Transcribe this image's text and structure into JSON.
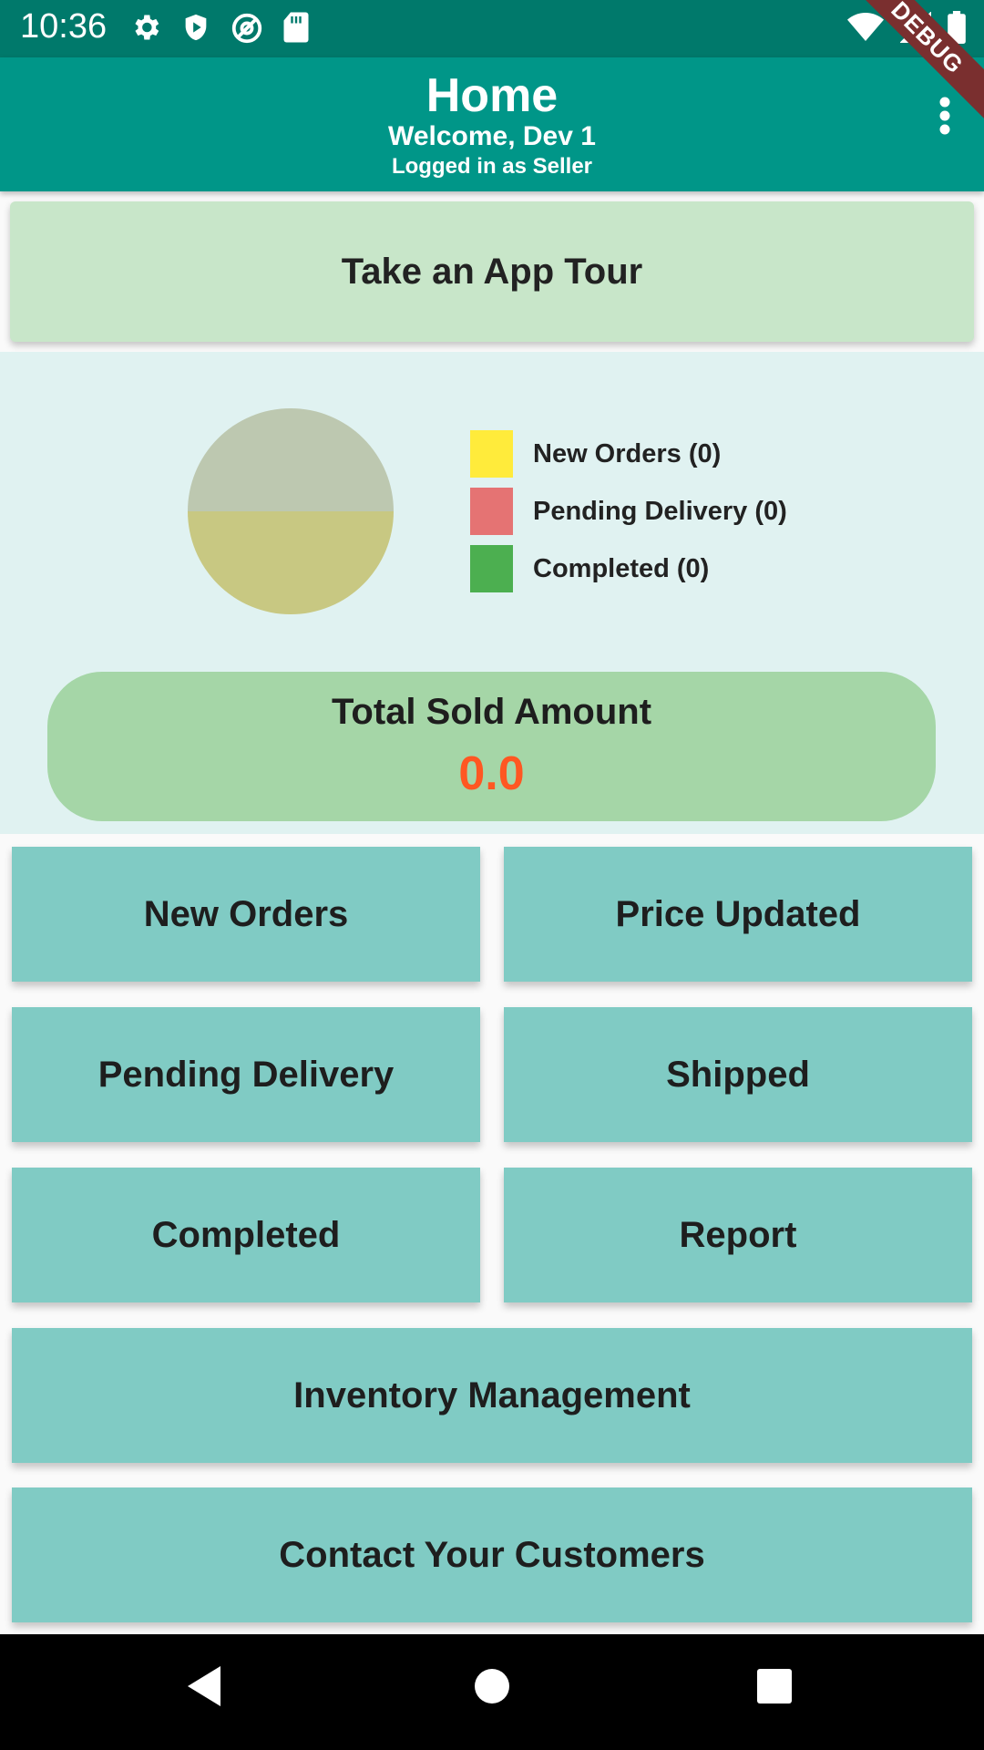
{
  "status_bar": {
    "time": "10:36",
    "left_icons": [
      "settings-icon",
      "shield-play-icon",
      "at-sign-icon",
      "sd-card-icon"
    ],
    "right_icons": [
      "wifi-icon",
      "signal-icon",
      "battery-icon"
    ],
    "debug_banner": "DEBUG"
  },
  "app_bar": {
    "title": "Home",
    "subtitle": "Welcome, Dev 1",
    "role_text": "Logged in as Seller",
    "menu_icon": "more-vert-icon"
  },
  "tour_button": {
    "label": "Take an App Tour"
  },
  "chart_data": {
    "type": "pie",
    "categories": [
      "New Orders",
      "Pending Delivery",
      "Completed"
    ],
    "values": [
      0,
      0,
      0
    ],
    "legend": [
      "New Orders (0)",
      "Pending Delivery (0)",
      "Completed (0)"
    ],
    "colors": [
      "#ffeb3b",
      "#e57373",
      "#4caf50"
    ],
    "legend_placement": "right"
  },
  "sold": {
    "title": "Total Sold Amount",
    "value": "0.0",
    "value_color": "#ff5722"
  },
  "tiles": {
    "new_orders": "New Orders",
    "price_updated": "Price Updated",
    "pending_delivery": "Pending Delivery",
    "shipped": "Shipped",
    "completed": "Completed",
    "report": "Report",
    "inventory": "Inventory Management",
    "contact": "Contact Your Customers"
  },
  "nav_bar": {
    "icons": [
      "back-icon",
      "home-icon",
      "recents-icon"
    ]
  },
  "colors": {
    "primary": "#009688",
    "status_bar": "#00796b",
    "tile": "#80cbc4",
    "tour": "#c8e6c9",
    "panel": "#e0f2f1",
    "sold_card": "#a5d6a7"
  }
}
